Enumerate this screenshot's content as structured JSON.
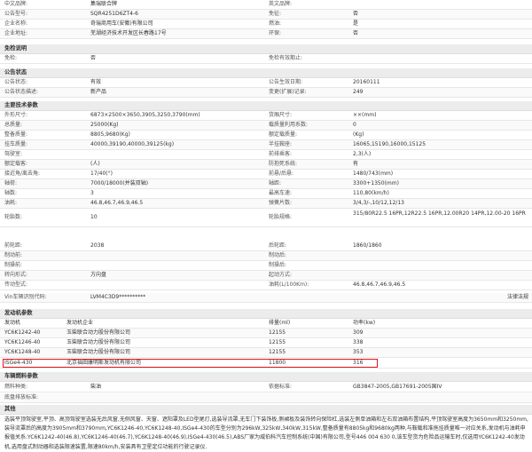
{
  "basic": {
    "rows": [
      [
        "中文品牌:",
        "集瑞联合牌",
        "英文品牌:",
        ""
      ],
      [
        "公告型号:",
        "SQR4251D6ZT4-6",
        "免征:",
        "否"
      ],
      [
        "企业名称:",
        "奇瑞商用车(安徽)有限公司",
        "燃油:",
        "是"
      ],
      [
        "企业地址:",
        "芜湖经济技术开发区长春路17号",
        "环保:",
        "否"
      ]
    ]
  },
  "exempt": {
    "title": "免检说明",
    "rows": [
      [
        "免检:",
        "否",
        "免检有效期止:",
        ""
      ]
    ]
  },
  "status": {
    "title": "公告状态",
    "rows": [
      [
        "公告状态:",
        "有效",
        "公告生效日期:",
        "20160111"
      ],
      [
        "公告状态描述:",
        "新产品",
        "变更(扩展)记录:",
        "249"
      ]
    ]
  },
  "tech": {
    "title": "主要技术参数",
    "rows": [
      [
        "外形尺寸:",
        "6873×2500×3650,3905,3250,3790(mm)",
        "货厢尺寸:",
        "××(mm)"
      ],
      [
        "总质量:",
        "25000(Kg)",
        "载质量利用系数:",
        "0"
      ],
      [
        "整备质量:",
        "8805,9680(Kg)",
        "额定载质量:",
        "(Kg)"
      ],
      [
        "挂车质量:",
        "40000,39190,40000,39125(kg)",
        "半挂鞍座:",
        "16065,15190,16000,15125"
      ],
      [
        "驾驶室:",
        "",
        "前排乘客:",
        "2,3(人)"
      ],
      [
        "额定载客:",
        "(人)",
        "防抱死系统:",
        "有"
      ],
      [
        "接近角/离去角:",
        "17/40(°)",
        "前悬/后悬:",
        "1480/743(mm)"
      ],
      [
        "轴荷:",
        "7000/18000(并装双轴)",
        "轴距:",
        "3300+1350(mm)"
      ],
      [
        "轴数:",
        "3",
        "最高车速:",
        "110,80(km/h)"
      ],
      [
        "油耗:",
        "46.8,46.7,46.9,46.5",
        "弹簧片数:",
        "3/4,3/-,10/12,12/13"
      ],
      [
        "轮胎数:",
        "10",
        "轮胎规格:",
        "315/80R22.5 16PR,12R22.5 16PR,12.00R20 14PR,12.00-20 16PR"
      ],
      [
        "前轮距:",
        "2038",
        "后轮距:",
        "1860/1860"
      ],
      [
        "制动前:",
        "",
        "制动后:",
        ""
      ],
      [
        "制操前:",
        "",
        "制操后:",
        ""
      ],
      [
        "转向形式:",
        "方向盘",
        "起动方式:",
        ""
      ],
      [
        "传动型式:",
        "",
        "油耗(L/100Km):",
        "46.8,46.7,46.9,46.5"
      ],
      [
        "Vin车辆识别代码:",
        "LVM4C3D9**********",
        "",
        ""
      ]
    ],
    "vin_right": "法律法规"
  },
  "engine": {
    "title": "发动机参数",
    "columns": [
      "发动机",
      "发动机企业",
      "排量(ml)",
      "功率(kw)"
    ],
    "rows": [
      [
        "YC6K1242-40",
        "玉柴联合动力股份有限公司",
        "12155",
        "309"
      ],
      [
        "YC6K1246-40",
        "玉柴联合动力股份有限公司",
        "12155",
        "338"
      ],
      [
        "YC6K1248-40",
        "玉柴联合动力股份有限公司",
        "12155",
        "353"
      ],
      [
        "ISGe4-430",
        "北京福田康明斯发动机有限公司",
        "11800",
        "316"
      ]
    ]
  },
  "fuel": {
    "title": "车辆燃料参数",
    "rows": [
      [
        "燃料种类:",
        "柴油",
        "依据标准:",
        "GB3847-2005,GB17691-2005国IV"
      ],
      [
        "底盘排放标准:",
        "",
        "",
        ""
      ]
    ]
  },
  "other": {
    "title": "其他",
    "text": "选装平顶驾驶室,平顶、高顶驾驶室选装无后风窗,无侧风窗、天窗、遮阳罩及LED型尾灯,选装导流罩,无车门下装饰板,侧裙板及装饰转向保险杠,选装左侧单油箱和左右双油箱布置结构,平顶驾驶室高度为3650mm和3250mm,装导流罩后的高度为3905mm和3790mm,YC6K1246-40,YC6K1248-40,ISGe4-430的车型分别为296kW,325kW,340kW,315kW,整备质量有8805kg和9680kg两种,与鞍载和准拖挂质量唯一对应关系,发动机与油耗申报值关系:YC6K1242-40(46.8),YC6K1246-40(46.7),YC6K1248-40(46.9),ISGe4-430(46.5),ABS厂家为威伯科汽车控制系统(中国)有限公司,型号446 004 630 0,该车型货为危险品运输车时,仅选用YC6K1242-40发动机,选用盘式制动器和选装限速装置,限速80km/h,安装具有卫星定位功能的行驶记录仪."
  }
}
